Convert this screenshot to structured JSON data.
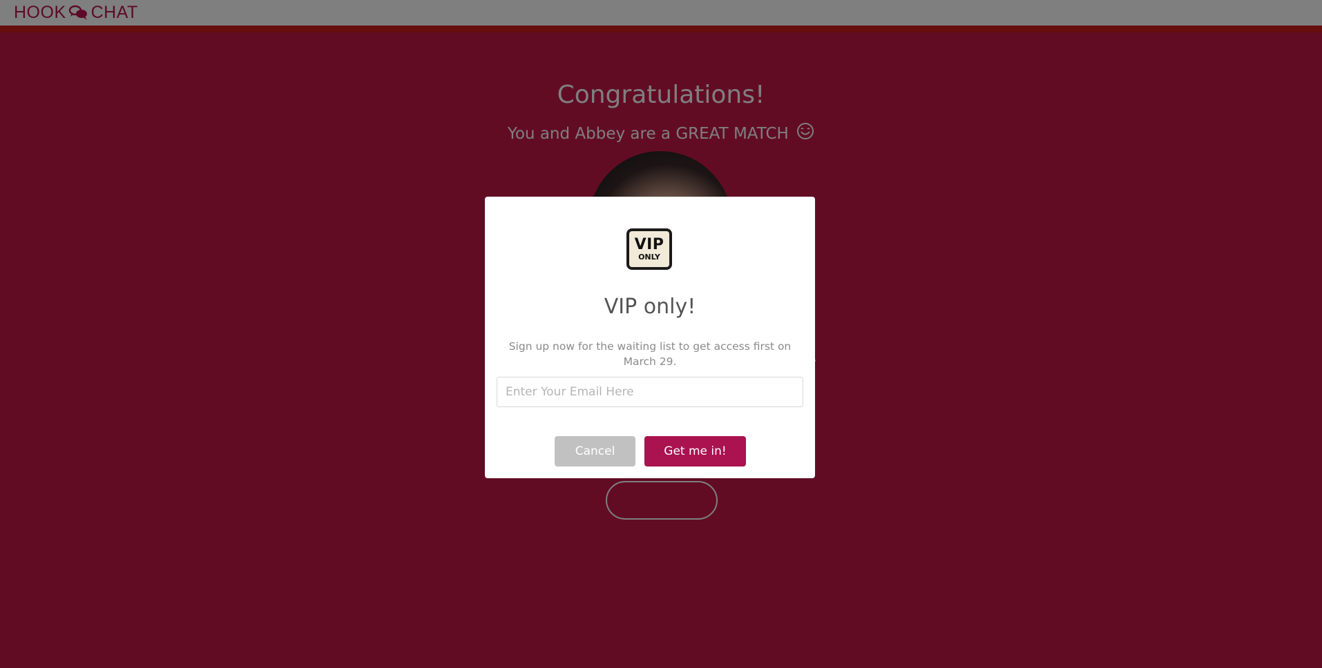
{
  "header": {
    "logo_left": "HOOK",
    "logo_right": "CHAT",
    "logo_icon": "chat-bubbles-icon"
  },
  "main": {
    "title": "Congratulations!",
    "match_text": "You and Abbey are a GREAT MATCH",
    "smiley_icon": "smiley-icon"
  },
  "modal": {
    "badge_big": "VIP",
    "badge_small": "ONLY",
    "title": "VIP only!",
    "text": "Sign up now for the waiting list to get access first on March 29.",
    "email_placeholder": "Enter Your Email Here",
    "cancel_label": "Cancel",
    "confirm_label": "Get me in!"
  },
  "colors": {
    "brand": "#c41848",
    "accent_button": "#aa1250",
    "cancel_button": "#c1c1c1",
    "header_border": "#cc1a1a"
  }
}
